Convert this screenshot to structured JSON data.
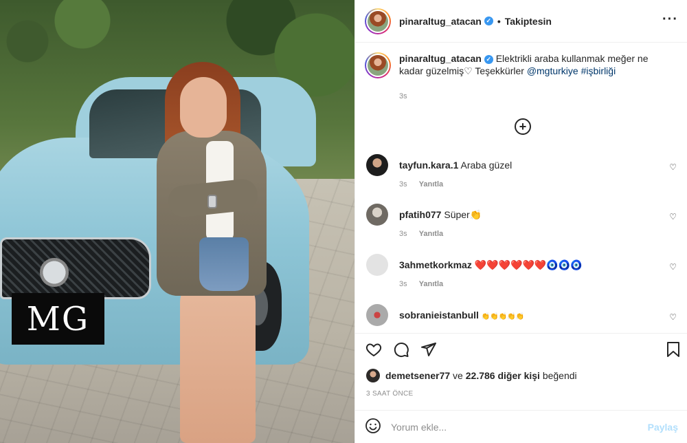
{
  "post": {
    "brand_tag": "MG"
  },
  "header": {
    "username": "pinaraltug_atacan",
    "separator": "•",
    "follow_status": "Takiptesin",
    "more_icon": "more-horizontal-icon"
  },
  "caption": {
    "username": "pinaraltug_atacan",
    "text": "Elektrikli araba kullanmak meğer ne kadar güzelmiş♡ Teşekkürler ",
    "mention": "@mgturkiye",
    "hashtag": "#işbirliği",
    "time": "3s"
  },
  "load_more_icon": "plus-circle-icon",
  "comments": [
    {
      "username": "tayfun.kara.1",
      "text": "Araba güzel",
      "time": "3s",
      "reply": "Yanıtla"
    },
    {
      "username": "pfatih077",
      "text": "Süper👏",
      "time": "3s",
      "reply": "Yanıtla"
    },
    {
      "username": "3ahmetkorkmaz",
      "text": "❤️❤️❤️❤️❤️❤️🧿🧿🧿",
      "time": "3s",
      "reply": "Yanıtla"
    },
    {
      "username": "sobranieistanbull",
      "text": "👏👏👏👏👏",
      "time": "",
      "reply": ""
    }
  ],
  "likes": {
    "user": "demetsener77",
    "middle": " ve ",
    "count_text": "22.786 diğer kişi",
    "suffix": " beğendi"
  },
  "time_ago": "3 SAAT ÖNCE",
  "comment_box": {
    "placeholder": "Yorum ekle...",
    "post_label": "Paylaş"
  },
  "colors": {
    "link": "#00376b",
    "verified": "#3897f0",
    "post_disabled": "#b2dffc",
    "muted": "#8e8e8e"
  }
}
